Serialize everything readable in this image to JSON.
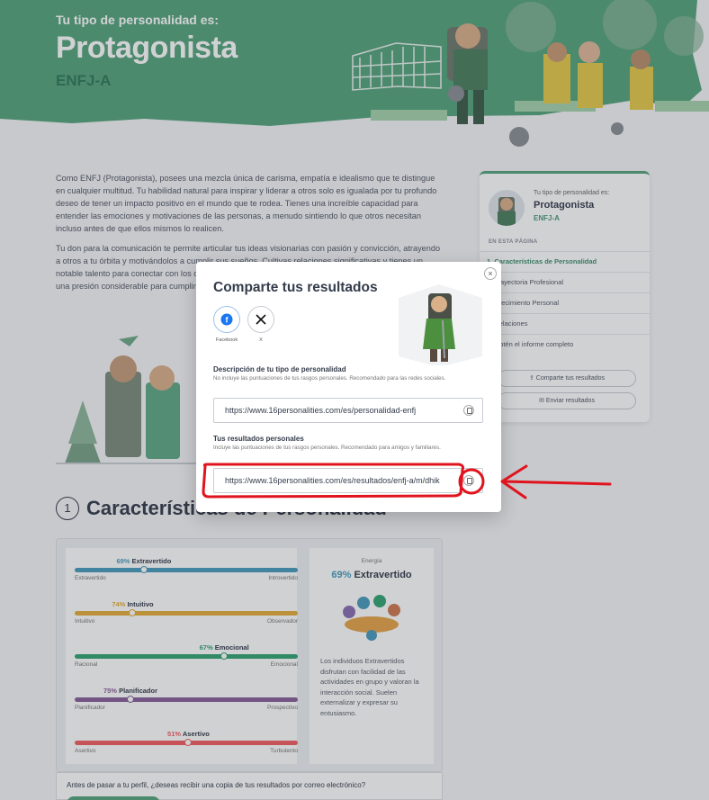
{
  "hero": {
    "subtitle": "Tu tipo de personalidad es:",
    "title": "Protagonista",
    "code": "ENFJ-A"
  },
  "intro": {
    "p1": "Como ENFJ (Protagonista), posees una mezcla única de carisma, empatía e idealismo que te distingue en cualquier multitud. Tu habilidad natural para inspirar y liderar a otros solo es igualada por tu profundo deseo de tener un impacto positivo en el mundo que te rodea. Tienes una increíble capacidad para entender las emociones y motivaciones de las personas, a menudo sintiendo lo que otros necesitan incluso antes de que ellos mismos lo realicen.",
    "p2": "Tu don para la comunicación te permite articular tus ideas visionarias con pasión y convicción, atrayendo a otros a tu órbita y motivándolos a cumplir sus sueños. Cultivas relaciones significativas y tienes un notable talento para conectar con los demás. Sin embargo, tu naturaleza idealista a veces puede ponerte una presión considerable para cumplir con tus elevadas expectativas."
  },
  "sidebar": {
    "label": "Tu tipo de personalidad es:",
    "name": "Protagonista",
    "code": "ENFJ-A",
    "section": "EN ESTA PÁGINA",
    "items": [
      "1. Características de Personalidad",
      "2. Trayectoria Profesional",
      "3. Crecimiento Personal",
      "4. Relaciones",
      "5. Obtén el informe completo"
    ],
    "share_button": "Comparte tus resultados",
    "email_button": "Enviar resultados"
  },
  "section1": {
    "number": "1",
    "title": "Características de Personalidad"
  },
  "traits": [
    {
      "percent": "69%",
      "name": "Extravertido",
      "left": "Extravertido",
      "right": "Introvertido",
      "value": 0.31,
      "color": "#4a9bbd",
      "bar": "#4a9bbd"
    },
    {
      "percent": "74%",
      "name": "Intuitivo",
      "left": "Intuitivo",
      "right": "Observador",
      "value": 0.26,
      "color": "#e4ae3a",
      "bar": "#e4ae3a"
    },
    {
      "percent": "67%",
      "name": "Emocional",
      "left": "Racional",
      "right": "Emocional",
      "value": 0.67,
      "color": "#33a474",
      "bar": "#33a474"
    },
    {
      "percent": "75%",
      "name": "Planificador",
      "left": "Planificador",
      "right": "Prospectivo",
      "value": 0.25,
      "color": "#88619a",
      "bar": "#88619a"
    },
    {
      "percent": "51%",
      "name": "Asertivo",
      "left": "Asertivo",
      "right": "Turbulento",
      "value": 0.51,
      "color": "#f25e62",
      "bar": "#f25e62"
    }
  ],
  "trait_side": {
    "label": "Energía",
    "percent": "69%",
    "name": "Extravertido",
    "description": "Los individuos Extravertidos disfrutan con facilidad de las actividades en grupo y valoran la interacción social. Suelen externalizar y expresar su entusiasmo."
  },
  "bottom": {
    "question": "Antes de pasar a tu perfil, ¿deseas recibir una copia de tus resultados por correo electrónico?"
  },
  "modal": {
    "close": "×",
    "title": "Comparte tus resultados",
    "facebook_label": "Facebook",
    "x_label": "X",
    "type_title": "Descripción de tu tipo de personalidad",
    "type_desc": "No incluye las puntuaciones de tus rasgos personales. Recomendado para las redes sociales.",
    "type_url": "https://www.16personalities.com/es/personalidad-enfj",
    "results_title": "Tus resultados personales",
    "results_desc": "Incluye las puntuaciones de tus rasgos personales. Recomendado para amigos y familiares.",
    "results_url": "https://www.16personalities.com/es/resultados/enfj-a/m/dhik"
  },
  "colors": {
    "hero_green": "#56a57e",
    "accent": "#33a474",
    "annotation_red": "#e0141e"
  }
}
